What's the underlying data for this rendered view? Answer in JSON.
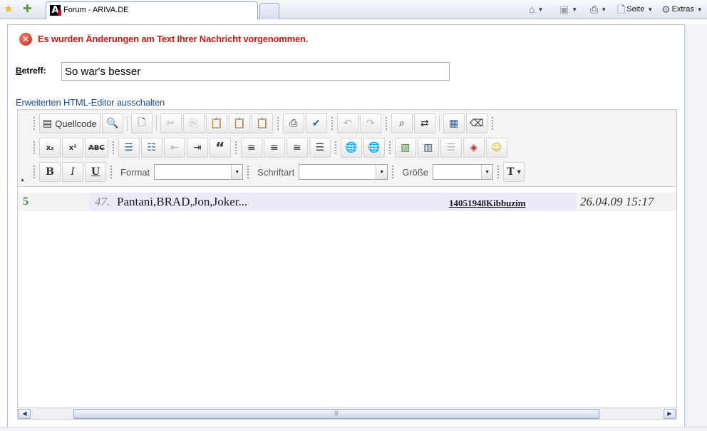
{
  "browser": {
    "tab_title": "Forum - ARIVA.DE",
    "tab_logo": "A",
    "commands": {
      "page_label": "Seite",
      "extras_label": "Extras"
    }
  },
  "page": {
    "error_message": "Es wurden Änderungen am Text Ihrer Nachricht vorgenommen.",
    "subject_label_first": "B",
    "subject_label_rest": "etreff:",
    "subject_value": "So war's besser",
    "editor_toggle_link": "Erweiterten HTML-Editor ausschalten"
  },
  "editor": {
    "source_button_label": "Quellcode",
    "format_label": "Format",
    "font_label": "Schriftart",
    "size_label": "Größe",
    "format_value": "",
    "font_value": "",
    "size_value": "",
    "bold_label": "B",
    "italic_label": "I",
    "underline_label": "U",
    "subscript_label": "x₂",
    "superscript_label": "x²",
    "strike_label": "ABC",
    "blockquote_label": "“"
  },
  "content": {
    "row": {
      "answers": "5",
      "index": "47.",
      "title": "Pantani,BRAD,Jon,Joker...",
      "user": "14051948Kibbuzim",
      "date": "26.04.09 15:17"
    }
  },
  "icons": {
    "favorites": "star-icon",
    "add_favorites": "add-favorite-icon",
    "home": "home-icon",
    "feeds": "rss-feed-icon",
    "print": "printer-icon",
    "page": "page-icon",
    "tools": "gear-icon",
    "error": "error-circle-icon"
  },
  "colors": {
    "error_text": "#c01b14",
    "link": "#1f4f9a",
    "answers_green": "#3e8a3a",
    "row_highlight": "#ebeaf7"
  }
}
